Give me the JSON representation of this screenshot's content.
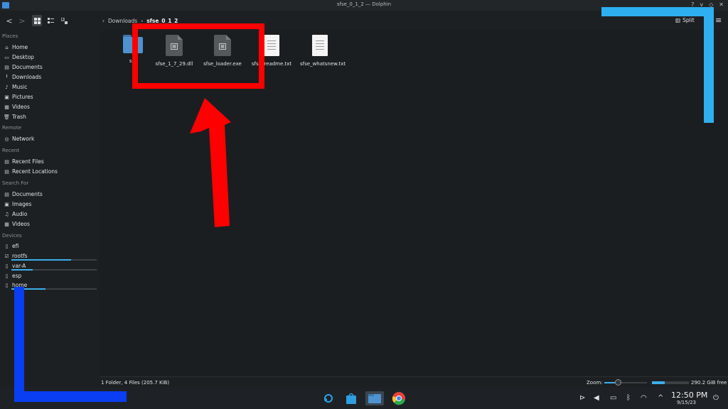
{
  "window": {
    "title": "sfse_0_1_2 — Dolphin",
    "controls": [
      "?",
      "v",
      "◇",
      "✕"
    ]
  },
  "toolbar": {
    "back": "<",
    "forward": ">",
    "view_modes": [
      "icons",
      "compact",
      "details"
    ],
    "breadcrumb": [
      "Downloads",
      "sfse_0_1_2"
    ],
    "split_label": "Split"
  },
  "sidebar": {
    "places_header": "Places",
    "places": [
      {
        "label": "Home",
        "icon": "home-icon"
      },
      {
        "label": "Desktop",
        "icon": "desktop-icon"
      },
      {
        "label": "Documents",
        "icon": "documents-icon"
      },
      {
        "label": "Downloads",
        "icon": "downloads-icon"
      },
      {
        "label": "Music",
        "icon": "music-icon"
      },
      {
        "label": "Pictures",
        "icon": "pictures-icon"
      },
      {
        "label": "Videos",
        "icon": "videos-icon"
      },
      {
        "label": "Trash",
        "icon": "trash-icon"
      }
    ],
    "remote_header": "Remote",
    "remote": [
      {
        "label": "Network",
        "icon": "network-icon"
      }
    ],
    "recent_header": "Recent",
    "recent": [
      {
        "label": "Recent Files",
        "icon": "recent-files-icon"
      },
      {
        "label": "Recent Locations",
        "icon": "recent-locations-icon"
      }
    ],
    "search_header": "Search For",
    "search": [
      {
        "label": "Documents",
        "icon": "search-documents-icon"
      },
      {
        "label": "Images",
        "icon": "images-icon"
      },
      {
        "label": "Audio",
        "icon": "audio-icon"
      },
      {
        "label": "Videos",
        "icon": "search-videos-icon"
      }
    ],
    "devices_header": "Devices",
    "devices": [
      {
        "label": "efi",
        "icon": "drive-icon",
        "usage": null
      },
      {
        "label": "rootfs",
        "icon": "drive-icon",
        "usage": 0.7
      },
      {
        "label": "var-A",
        "icon": "drive-icon",
        "usage": 0.25
      },
      {
        "label": "esp",
        "icon": "drive-icon",
        "usage": null
      },
      {
        "label": "home",
        "icon": "drive-icon",
        "usage": 0.4
      }
    ]
  },
  "files": [
    {
      "name": "src",
      "type": "folder"
    },
    {
      "name": "sfse_1_7_29.dll",
      "type": "binary"
    },
    {
      "name": "sfse_loader.exe",
      "type": "binary"
    },
    {
      "name": "sfse_readme.txt",
      "type": "text"
    },
    {
      "name": "sfse_whatsnew.txt",
      "type": "text"
    }
  ],
  "statusbar": {
    "summary": "1 Folder, 4 Files (205.7 KiB)",
    "zoom_label": "Zoom:",
    "zoom_level": 0.25,
    "free_space": "290.2 GiB free",
    "used_fraction": 0.35
  },
  "taskbar": {
    "apps": [
      "steam-icon",
      "store-icon",
      "files-icon",
      "chrome-icon"
    ],
    "time": "12:50 PM",
    "date": "9/15/23"
  },
  "colors": {
    "annotation_red": "#ff0000",
    "bracket_cyan": "#2eaff0",
    "bracket_blue": "#0a3ef2",
    "accent": "#3daee9"
  }
}
